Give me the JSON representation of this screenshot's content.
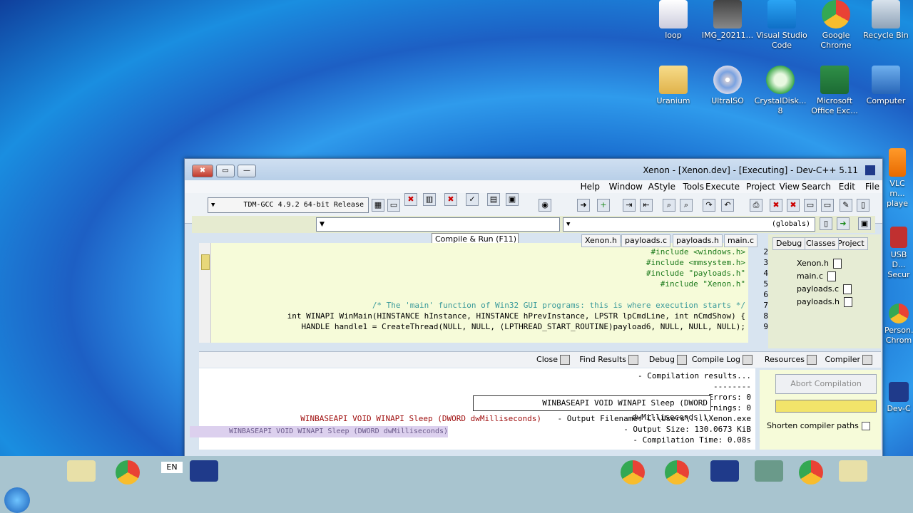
{
  "desktop_icons": [
    {
      "label": "loop",
      "icon": "loop-icon"
    },
    {
      "label": "IMG_20211...",
      "icon": "image-icon"
    },
    {
      "label": "Visual Studio Code",
      "icon": "vscode-icon"
    },
    {
      "label": "Google Chrome",
      "icon": "chrome-icon"
    },
    {
      "label": "Recycle Bin",
      "icon": "recycle-bin-icon"
    },
    {
      "label": "Uranium",
      "icon": "folder-icon"
    },
    {
      "label": "UltraISO",
      "icon": "disc-icon"
    },
    {
      "label": "CrystalDisk... 8",
      "icon": "crystaldisk-icon"
    },
    {
      "label": "Microsoft Office Exc...",
      "icon": "excel-icon"
    },
    {
      "label": "Computer",
      "icon": "computer-icon"
    },
    {
      "label": "VLC m... playe",
      "icon": "vlc-icon"
    },
    {
      "label": "USB D... Secur",
      "icon": "usb-icon"
    },
    {
      "label": "Person... Chrom",
      "icon": "chrome-person-icon"
    },
    {
      "label": "Dev-C",
      "icon": "devcpp-icon"
    }
  ],
  "window": {
    "title": "Xenon - [Xenon.dev] - [Executing] - Dev-C++ 5.11",
    "close_symbol": "✖",
    "max_symbol": "▭",
    "min_symbol": "—"
  },
  "menu": [
    "File",
    "Edit",
    "Search",
    "View",
    "Project",
    "Execute",
    "Tools",
    "AStyle",
    "Window",
    "Help"
  ],
  "toolbar": {
    "compiler_select": "TDM-GCC 4.9.2 64-bit Release"
  },
  "scope": {
    "globals": "(globals)"
  },
  "tooltip": "Compile & Run (F11)",
  "project_tabs": [
    "Project",
    "Classes",
    "Debug"
  ],
  "project_files": [
    "Xenon.h",
    "main.c",
    "payloads.c",
    "payloads.h"
  ],
  "editor_tabs": [
    "main.c",
    "payloads.h",
    "payloads.c",
    "Xenon.h"
  ],
  "code_lines": [
    {
      "n": "2",
      "text": "#include <windows.h>",
      "cls": "c-inc"
    },
    {
      "n": "3",
      "text": "#include <mmsystem.h>",
      "cls": "c-inc"
    },
    {
      "n": "4",
      "text": "#include \"payloads.h\"",
      "cls": "c-inc"
    },
    {
      "n": "5",
      "text": "#include \"Xenon.h\"",
      "cls": "c-inc"
    },
    {
      "n": "6",
      "text": "",
      "cls": ""
    },
    {
      "n": "7",
      "text": "/* The 'main' function of Win32 GUI programs: this is where execution starts */",
      "cls": "c-cmt"
    },
    {
      "n": "8",
      "text": "int WINAPI WinMain(HINSTANCE hInstance, HINSTANCE hPrevInstance, LPSTR lpCmdLine, int nCmdShow) {",
      "cls": ""
    },
    {
      "n": "9",
      "text": "HANDLE handle1 = CreateThread(NULL, NULL, (LPTHREAD_START_ROUTINE)payload6, NULL, NULL, NULL);",
      "cls": ""
    }
  ],
  "bottom_tabs": [
    "Compiler",
    "Resources",
    "Compile Log",
    "Debug",
    "Find Results",
    "Close"
  ],
  "log_lines": [
    "- Compilation results...",
    "--------",
    "- Errors: 0",
    "- Warnings: 0",
    "- Output Filename: C:\\Users\\...\\Xenon.exe",
    "- Output Size: 130.0673 KiB",
    "- Compilation Time: 0.08s"
  ],
  "callout_text": "WINBASEAPI VOID WINAPI Sleep (DWORD dwMilliseconds))",
  "log_overlay": "WINBASEAPI VOID WINAPI Sleep (DWORD dwMilliseconds)",
  "ghost_text": "WINBASEAPI VOID WINAPI Sleep (DWORD dwMilliseconds)",
  "side": {
    "abort_label": "Abort Compilation",
    "shorten_label": "Shorten compiler paths"
  },
  "taskbar": {
    "lang": "EN"
  }
}
